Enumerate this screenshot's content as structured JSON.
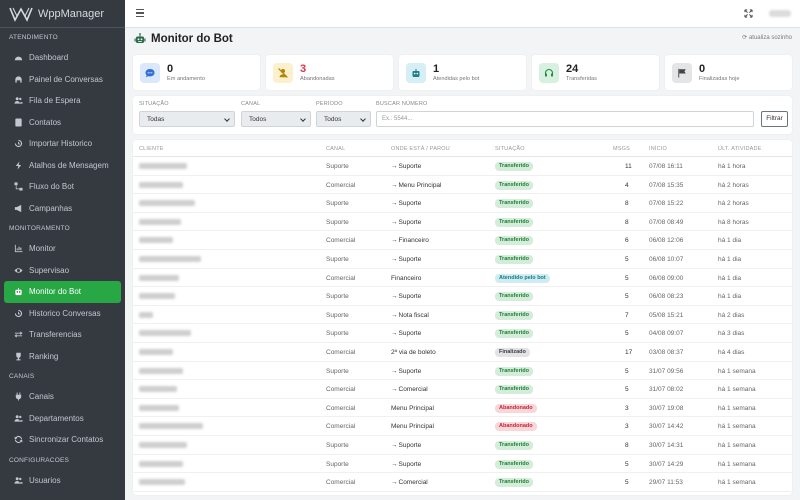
{
  "app": {
    "name": "WppManager"
  },
  "sidebar": {
    "sections": [
      {
        "title": "ATENDIMENTO",
        "items": [
          {
            "label": "Dashboard",
            "icon": "gauge-icon"
          },
          {
            "label": "Painel de Conversas",
            "icon": "headset-icon"
          },
          {
            "label": "Fila de Espera",
            "icon": "users-icon"
          },
          {
            "label": "Contatos",
            "icon": "address-book-icon"
          },
          {
            "label": "Importar Historico",
            "icon": "history-icon"
          },
          {
            "label": "Atalhos de Mensagem",
            "icon": "bolt-icon"
          },
          {
            "label": "Fluxo do Bot",
            "icon": "flow-icon"
          },
          {
            "label": "Campanhas",
            "icon": "megaphone-icon"
          }
        ]
      },
      {
        "title": "MONITORAMENTO",
        "items": [
          {
            "label": "Monitor",
            "icon": "chart-icon"
          },
          {
            "label": "Supervisao",
            "icon": "eye-icon"
          },
          {
            "label": "Monitor do Bot",
            "icon": "robot-icon",
            "active": true
          },
          {
            "label": "Historico Conversas",
            "icon": "history-icon"
          },
          {
            "label": "Transferencias",
            "icon": "exchange-icon"
          },
          {
            "label": "Ranking",
            "icon": "trophy-icon"
          }
        ]
      },
      {
        "title": "CANAIS",
        "items": [
          {
            "label": "Canais",
            "icon": "plug-icon"
          },
          {
            "label": "Departamentos",
            "icon": "users-icon"
          },
          {
            "label": "Sincronizar Contatos",
            "icon": "sync-icon"
          }
        ]
      },
      {
        "title": "CONFIGURACOES",
        "items": [
          {
            "label": "Usuarios",
            "icon": "users-icon"
          }
        ]
      }
    ]
  },
  "page": {
    "title": "Monitor do Bot",
    "auto_refresh": "atualiza sozinho"
  },
  "stats": [
    {
      "value": "0",
      "label": "Em andamento",
      "icon": "chat-icon",
      "bg": "#dbe7fb",
      "fg": "#2f6fd6",
      "value_color": "#222"
    },
    {
      "value": "3",
      "label": "Abandonadas",
      "icon": "user-slash-icon",
      "bg": "#fdf0cf",
      "fg": "#b38600",
      "value_color": "#dc3545"
    },
    {
      "value": "1",
      "label": "Atendidas pelo bot",
      "icon": "robot-icon",
      "bg": "#d6eff5",
      "fg": "#1f7c8f",
      "value_color": "#222"
    },
    {
      "value": "24",
      "label": "Transferidas",
      "icon": "headset-icon",
      "bg": "#d8f0df",
      "fg": "#218d3e",
      "value_color": "#222"
    },
    {
      "value": "0",
      "label": "Finalizadas hoje",
      "icon": "flag-icon",
      "bg": "#e4e5e7",
      "fg": "#444",
      "value_color": "#222"
    }
  ],
  "filters": {
    "situacao": {
      "label": "SITUAÇÃO",
      "value": "Todas"
    },
    "canal": {
      "label": "CANAL",
      "value": "Todos"
    },
    "periodo": {
      "label": "PERÍODO",
      "value": "Todos"
    },
    "buscar": {
      "label": "BUSCAR NÚMERO",
      "placeholder": "Ex.: 5544..."
    },
    "button": "Filtrar"
  },
  "table": {
    "columns": [
      "CLIENTE",
      "CANAL",
      "ONDE ESTÁ / PAROU",
      "SITUAÇÃO",
      "MSGS",
      "INÍCIO",
      "ÚLT. ATIVIDADE"
    ],
    "status_styles": {
      "Transferido": {
        "bg": "#d4edda",
        "fg": "#1e7e34"
      },
      "Atendido pelo bot": {
        "bg": "#d1ecf1",
        "fg": "#117a8b"
      },
      "Finalizado": {
        "bg": "#e2e3e5",
        "fg": "#383d41"
      },
      "Abandonado": {
        "bg": "#f8d7da",
        "fg": "#c82333"
      }
    },
    "rows": [
      {
        "canal": "Suporte",
        "onde": "Suporte",
        "arrow": true,
        "status": "Transferido",
        "msgs": "11",
        "inicio": "07/08 16:11",
        "ult": "há 1 hora"
      },
      {
        "canal": "Comercial",
        "onde": "Menu Principal",
        "arrow": true,
        "status": "Transferido",
        "msgs": "4",
        "inicio": "07/08 15:35",
        "ult": "há 2 horas"
      },
      {
        "canal": "Suporte",
        "onde": "Suporte",
        "arrow": true,
        "status": "Transferido",
        "msgs": "8",
        "inicio": "07/08 15:22",
        "ult": "há 2 horas"
      },
      {
        "canal": "Suporte",
        "onde": "Suporte",
        "arrow": true,
        "status": "Transferido",
        "msgs": "8",
        "inicio": "07/08 08:49",
        "ult": "há 8 horas"
      },
      {
        "canal": "Comercial",
        "onde": "Financeiro",
        "arrow": true,
        "status": "Transferido",
        "msgs": "6",
        "inicio": "06/08 12:06",
        "ult": "há 1 dia"
      },
      {
        "canal": "Suporte",
        "onde": "Suporte",
        "arrow": true,
        "status": "Transferido",
        "msgs": "5",
        "inicio": "06/08 10:07",
        "ult": "há 1 dia"
      },
      {
        "canal": "Comercial",
        "onde": "Financeiro",
        "arrow": false,
        "status": "Atendido pelo bot",
        "msgs": "5",
        "inicio": "06/08 09:00",
        "ult": "há 1 dia"
      },
      {
        "canal": "Suporte",
        "onde": "Suporte",
        "arrow": true,
        "status": "Transferido",
        "msgs": "5",
        "inicio": "06/08 08:23",
        "ult": "há 1 dia"
      },
      {
        "canal": "Suporte",
        "onde": "Nota fiscal",
        "arrow": true,
        "status": "Transferido",
        "msgs": "7",
        "inicio": "05/08 15:21",
        "ult": "há 2 dias"
      },
      {
        "canal": "Suporte",
        "onde": "Suporte",
        "arrow": true,
        "status": "Transferido",
        "msgs": "5",
        "inicio": "04/08 09:07",
        "ult": "há 3 dias"
      },
      {
        "canal": "Comercial",
        "onde": "2ª via de boleto",
        "arrow": false,
        "status": "Finalizado",
        "msgs": "17",
        "inicio": "03/08 08:37",
        "ult": "há 4 dias"
      },
      {
        "canal": "Suporte",
        "onde": "Suporte",
        "arrow": true,
        "status": "Transferido",
        "msgs": "5",
        "inicio": "31/07 09:56",
        "ult": "há 1 semana"
      },
      {
        "canal": "Comercial",
        "onde": "Comercial",
        "arrow": true,
        "status": "Transferido",
        "msgs": "5",
        "inicio": "31/07 08:02",
        "ult": "há 1 semana"
      },
      {
        "canal": "Comercial",
        "onde": "Menu Principal",
        "arrow": false,
        "status": "Abandonado",
        "msgs": "3",
        "inicio": "30/07 19:08",
        "ult": "há 1 semana"
      },
      {
        "canal": "Comercial",
        "onde": "Menu Principal",
        "arrow": false,
        "status": "Abandonado",
        "msgs": "3",
        "inicio": "30/07 14:42",
        "ult": "há 1 semana"
      },
      {
        "canal": "Suporte",
        "onde": "Suporte",
        "arrow": true,
        "status": "Transferido",
        "msgs": "8",
        "inicio": "30/07 14:31",
        "ult": "há 1 semana"
      },
      {
        "canal": "Suporte",
        "onde": "Suporte",
        "arrow": true,
        "status": "Transferido",
        "msgs": "5",
        "inicio": "30/07 14:29",
        "ult": "há 1 semana"
      },
      {
        "canal": "Comercial",
        "onde": "Comercial",
        "arrow": true,
        "status": "Transferido",
        "msgs": "5",
        "inicio": "29/07 11:53",
        "ult": "há 1 semana"
      }
    ]
  }
}
